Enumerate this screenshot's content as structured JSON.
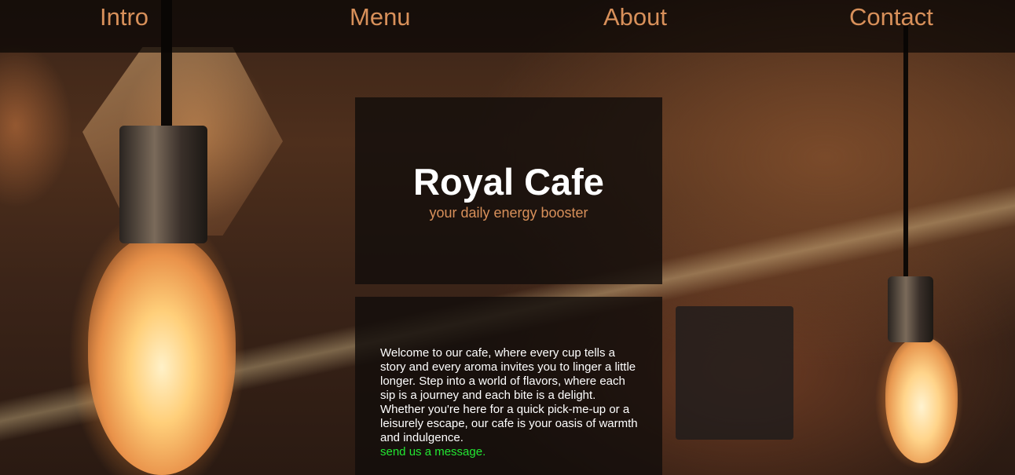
{
  "nav": {
    "items": [
      {
        "label": "Intro"
      },
      {
        "label": "Menu"
      },
      {
        "label": "About"
      },
      {
        "label": "Contact"
      }
    ]
  },
  "hero": {
    "title": "Royal Cafe",
    "subtitle": "your daily energy booster"
  },
  "welcome": {
    "text": "Welcome to our cafe, where every cup tells a story and every aroma invites you to linger a little longer. Step into a world of flavors, where each sip is a journey and each bite is a delight. Whether you're here for a quick pick-me-up or a leisurely escape, our cafe is your oasis of warmth and indulgence.",
    "link_label": "send us a message."
  },
  "colors": {
    "accent": "#d8905a",
    "link": "#22e632",
    "card_bg": "#120d0b"
  }
}
